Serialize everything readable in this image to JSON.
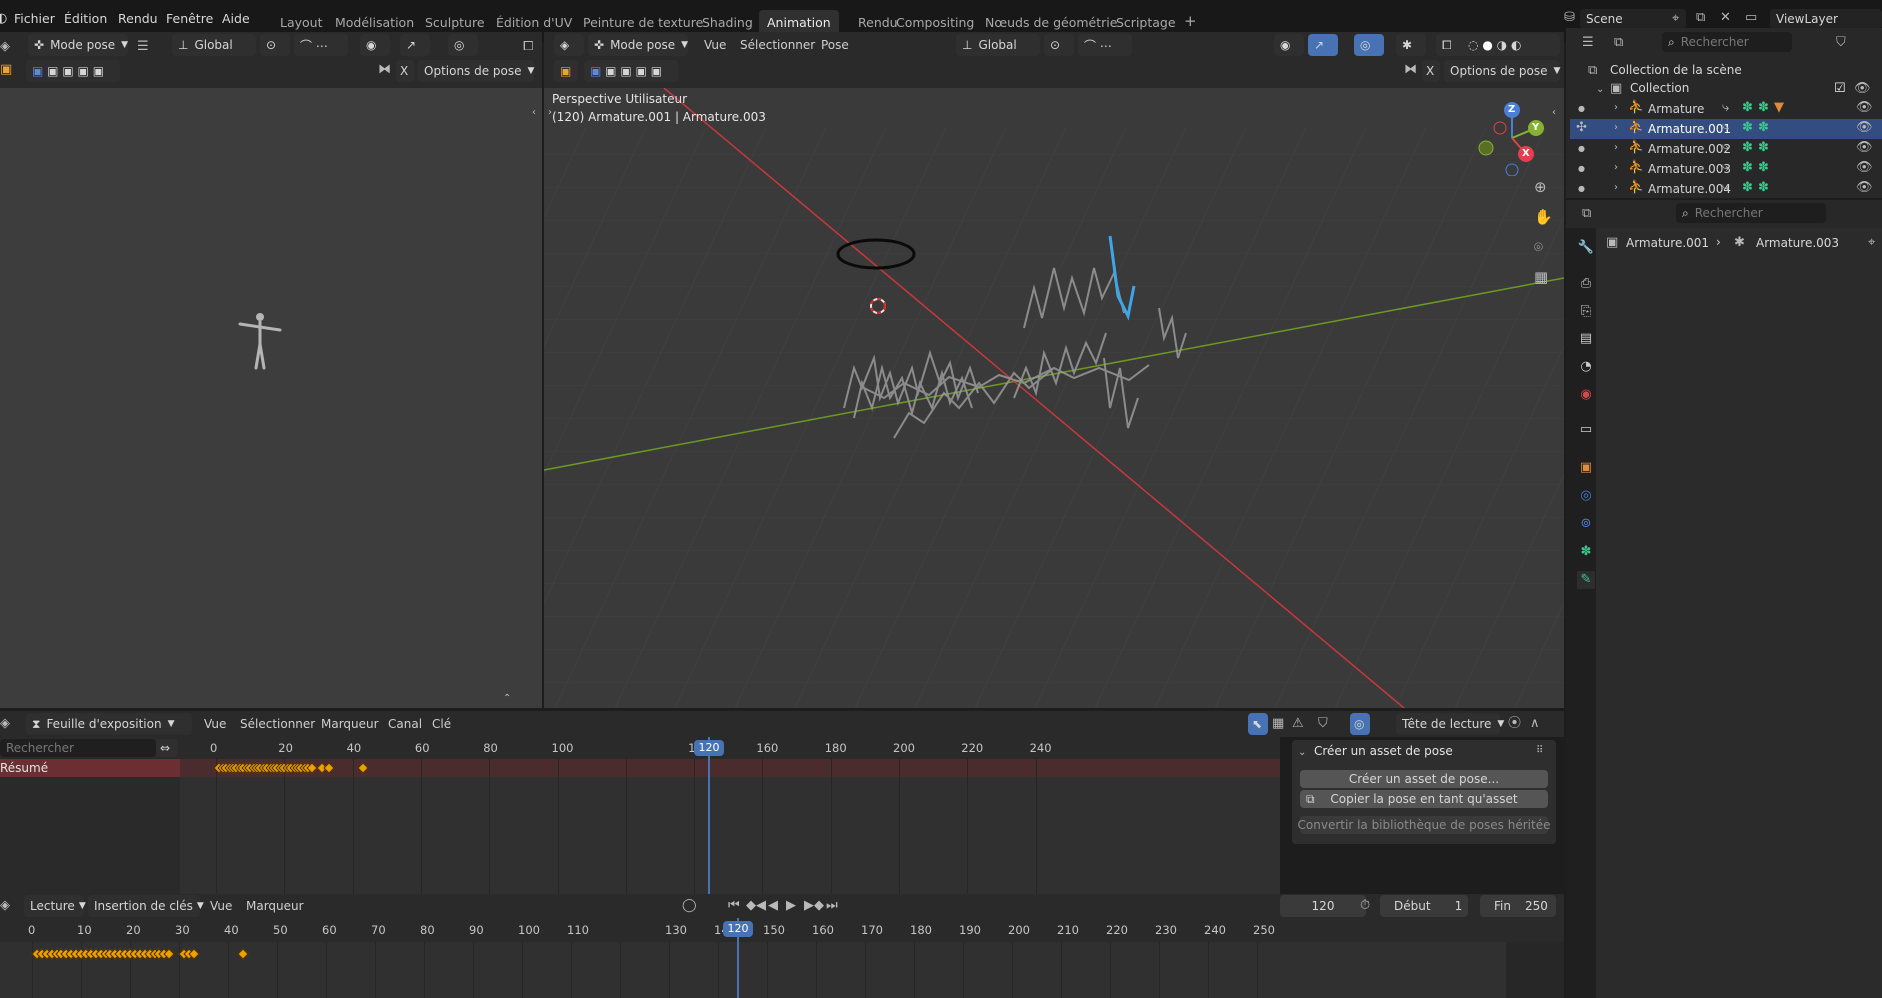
{
  "topbar": {
    "menus": [
      "Fichier",
      "Édition",
      "Rendu",
      "Fenêtre",
      "Aide"
    ],
    "workspaces": [
      "Layout",
      "Modélisation",
      "Sculpture",
      "Édition d'UV",
      "Peinture de texture",
      "Shading",
      "Animation",
      "Rendu",
      "Compositing",
      "Nœuds de géométrie",
      "Scriptage"
    ],
    "active_workspace": "Animation",
    "add_workspace": "+",
    "scene": "Scene",
    "view_layer": "ViewLayer"
  },
  "left_view": {
    "mode": "Mode pose",
    "orientation": "Global",
    "options": "Options de pose",
    "x_label": "X"
  },
  "viewport": {
    "mode": "Mode pose",
    "menus": [
      "Vue",
      "Sélectionner",
      "Pose"
    ],
    "orientation": "Global",
    "options": "Options de pose",
    "x_label": "X",
    "info_line1": "Perspective Utilisateur",
    "info_line2": "(120) Armature.001 | Armature.003",
    "gizmo": {
      "x": "X",
      "y": "Y",
      "z": "Z"
    }
  },
  "outliner": {
    "search_placeholder": "Rechercher",
    "scene_collection": "Collection de la scène",
    "collection": "Collection",
    "items": [
      {
        "label": "Armature",
        "selected": false
      },
      {
        "label": "Armature.001",
        "selected": true
      },
      {
        "label": "Armature.002",
        "selected": false
      },
      {
        "label": "Armature.003",
        "selected": false
      },
      {
        "label": "Armature.004",
        "selected": false
      }
    ]
  },
  "properties": {
    "search_placeholder": "Rechercher",
    "breadcrumb_object": "Armature.001",
    "breadcrumb_bone": "Armature.003"
  },
  "dopesheet": {
    "editor_type": "Feuille d'exposition",
    "menus": [
      "Vue",
      "Sélectionner",
      "Marqueur",
      "Canal",
      "Clé"
    ],
    "playhead_mode": "Tête de lecture",
    "search_placeholder": "Rechercher",
    "channel": "Résumé",
    "ticks": [
      "0",
      "20",
      "40",
      "60",
      "80",
      "100",
      "120",
      "140",
      "160",
      "180",
      "200",
      "220",
      "240"
    ],
    "current_frame": "120",
    "panel": {
      "title": "Créer un asset de pose",
      "btn_create": "Créer un asset de pose...",
      "btn_copy": "Copier la pose en tant qu'asset",
      "btn_convert": "Convertir la bibliothèque de poses héritée"
    }
  },
  "timeline": {
    "menus": [
      "Lecture",
      "Insertion de clés",
      "Vue",
      "Marqueur"
    ],
    "frame": "120",
    "start_label": "Début",
    "start_value": "1",
    "end_label": "Fin",
    "end_value": "250",
    "ticks": [
      "0",
      "10",
      "20",
      "30",
      "40",
      "50",
      "60",
      "70",
      "80",
      "90",
      "100",
      "110",
      "120",
      "130",
      "140",
      "150",
      "160",
      "170",
      "180",
      "190",
      "200",
      "210",
      "220",
      "230",
      "240",
      "250"
    ],
    "current_frame": "120"
  },
  "colors": {
    "accent": "#4772b3",
    "keyframe": "#f0a000",
    "x_axis": "#c8383c",
    "y_axis": "#6b9a23"
  }
}
